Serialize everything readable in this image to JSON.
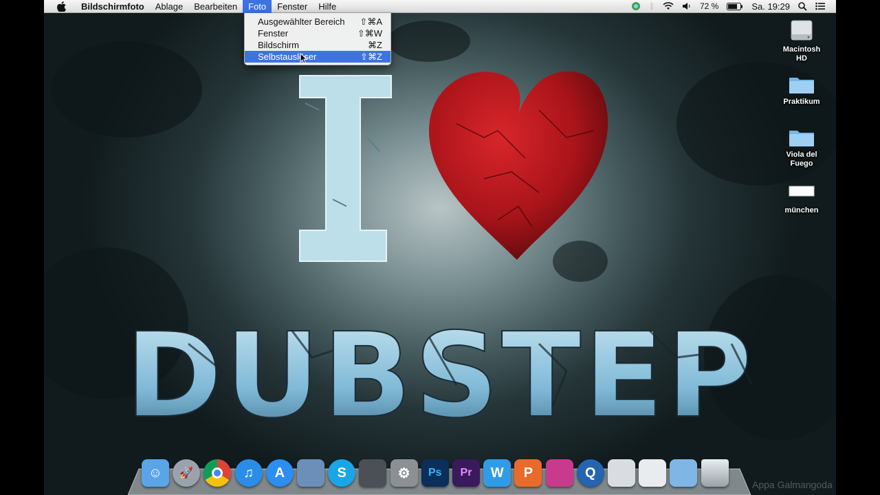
{
  "menubar": {
    "app_name": "Bildschirmfoto",
    "menus": [
      "Ablage",
      "Bearbeiten",
      "Foto",
      "Fenster",
      "Hilfe"
    ],
    "active_menu": "Foto",
    "battery": "72 %",
    "clock": "Sa. 19:29"
  },
  "dropdown": {
    "items": [
      {
        "label": "Ausgewählter Bereich",
        "shortcut": "⇧⌘A"
      },
      {
        "label": "Fenster",
        "shortcut": "⇧⌘W"
      },
      {
        "label": "Bildschirm",
        "shortcut": "⌘Z"
      },
      {
        "label": "Selbstauslöser",
        "shortcut": "⇧⌘Z"
      }
    ],
    "highlighted_index": 3
  },
  "desktop_icons": [
    {
      "label_line1": "Macintosh",
      "label_line2": "HD",
      "icon": "hard-drive-icon"
    },
    {
      "label_line1": "Praktikum",
      "label_line2": "",
      "icon": "folder-icon"
    },
    {
      "label_line1": "Viola del",
      "label_line2": "Fuego",
      "icon": "folder-icon"
    },
    {
      "label_line1": "münchen",
      "label_line2": "",
      "icon": "document-icon"
    }
  ],
  "wallpaper": {
    "word_top": "I",
    "word_bottom": "DUBSTEP",
    "heart_color": "#b4161a"
  },
  "dock": {
    "apps": [
      {
        "name": "finder-icon",
        "glyph": "☺",
        "color": "#5aa4e8"
      },
      {
        "name": "launchpad-icon",
        "glyph": "🚀",
        "color": "#9aa3ad"
      },
      {
        "name": "chrome-icon",
        "glyph": "",
        "color": "#db4437"
      },
      {
        "name": "itunes-icon",
        "glyph": "♫",
        "color": "#2a8ee8"
      },
      {
        "name": "app-store-icon",
        "glyph": "A",
        "color": "#2b8ef0"
      },
      {
        "name": "preview-icon",
        "glyph": "",
        "color": "#6b8fb8"
      },
      {
        "name": "skype-icon",
        "glyph": "S",
        "color": "#1aa5e6"
      },
      {
        "name": "steam-icon",
        "glyph": "",
        "color": "#4a5056"
      },
      {
        "name": "system-preferences-icon",
        "glyph": "⚙",
        "color": "#8c8f93"
      },
      {
        "name": "photoshop-icon",
        "glyph": "Ps",
        "color": "#0b2e5b"
      },
      {
        "name": "premiere-icon",
        "glyph": "Pr",
        "color": "#3a1a5c"
      },
      {
        "name": "word-icon",
        "glyph": "W",
        "color": "#2f9ce8"
      },
      {
        "name": "powerpoint-icon",
        "glyph": "P",
        "color": "#ea6a2a"
      },
      {
        "name": "photo-app-icon",
        "glyph": "",
        "color": "#c93a8c"
      },
      {
        "name": "quicktime-icon",
        "glyph": "Q",
        "color": "#2464b0"
      },
      {
        "name": "grapher-icon",
        "glyph": "",
        "color": "#d9dde1"
      },
      {
        "name": "documents-stack-icon",
        "glyph": "",
        "color": "#e9ecef"
      },
      {
        "name": "folder-stack-icon",
        "glyph": "",
        "color": "#7fb6e6"
      },
      {
        "name": "trash-icon",
        "glyph": "",
        "color": "#c8cdd2"
      }
    ]
  },
  "watermark": "Appa Galmangoda"
}
